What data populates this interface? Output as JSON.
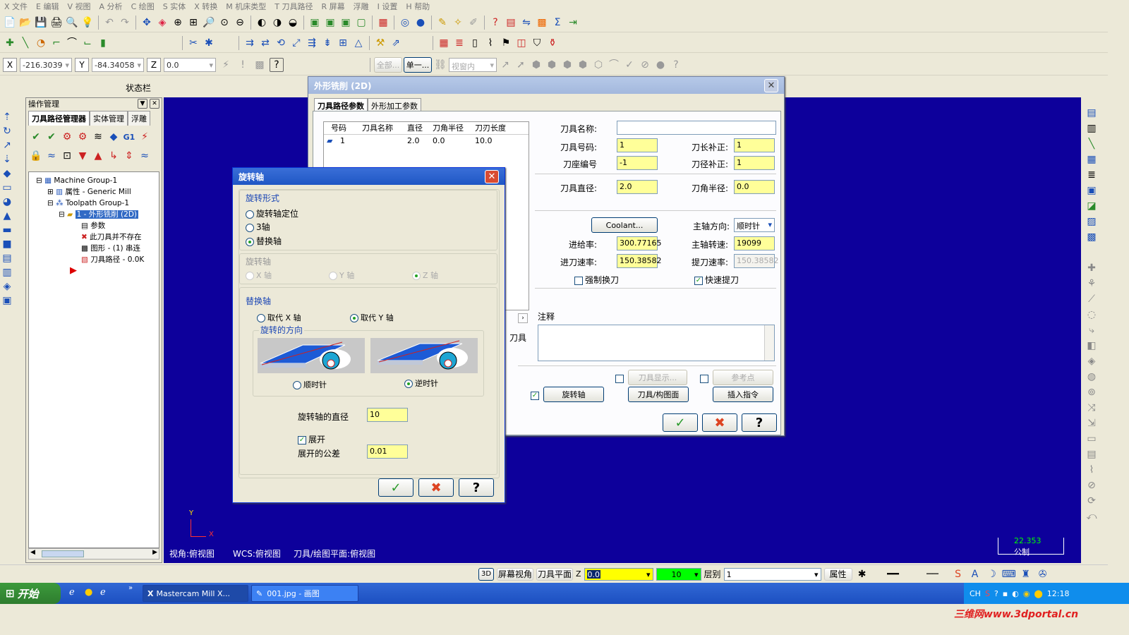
{
  "menu": [
    "X 文件",
    "E 编辑",
    "V 视图",
    "A 分析",
    "C 绘图",
    "S 实体",
    "X 转换",
    "M 机床类型",
    "T 刀具路径",
    "R 屏幕",
    "浮雕",
    "I 设置",
    "H 帮助"
  ],
  "coords": {
    "x_label": "X",
    "x_value": "-216.3039",
    "y_label": "Y",
    "y_value": "-84.34058",
    "z_label": "Z",
    "z_value": "0.0"
  },
  "toolbar3": {
    "all": "全部...",
    "single": "单一...",
    "view_in": "视窗内"
  },
  "status_bar_label": "状态栏",
  "ops": {
    "title": "操作管理",
    "tabs": [
      "刀具路径管理器",
      "实体管理",
      "浮雕"
    ],
    "tree": [
      "Machine Group-1",
      "属性 - Generic Mill",
      "Toolpath Group-1",
      "1 - 外形铣削 (2D)",
      "参数",
      "此刀具并不存在",
      "图形 - (1) 串连",
      "刀具路径 - 0.0K"
    ]
  },
  "viewport": {
    "view": "视角:俯视图",
    "wcs": "WCS:俯视图",
    "plane": "刀具/绘图平面:俯视图",
    "scale_value": "22.353",
    "scale_unit": "公制",
    "axis_y": "Y",
    "axis_x": "X"
  },
  "contour_dialog": {
    "title": "外形铣削 (2D)",
    "tabs": [
      "刀具路径参数",
      "外形加工参数"
    ],
    "tool_table": {
      "headers": [
        "号码",
        "刀具名称",
        "直径",
        "刀角半径",
        "刀刃长度"
      ],
      "row": [
        "1",
        "",
        "2.0",
        "0.0",
        "10.0"
      ]
    },
    "tool_name_label": "刀具名称:",
    "tool_name": "",
    "tool_num_label": "刀具号码:",
    "tool_num": "1",
    "len_comp_label": "刀长补正:",
    "len_comp": "1",
    "holder_label": "刀座编号",
    "holder": "-1",
    "dia_comp_label": "刀径补正:",
    "dia_comp": "1",
    "diameter_label": "刀具直径:",
    "diameter": "2.0",
    "corner_label": "刀角半径:",
    "corner": "0.0",
    "coolant": "Coolant...",
    "spindle_dir_label": "主轴方向:",
    "spindle_dir": "顺时针",
    "feed_label": "进给率:",
    "feed": "300.77165",
    "rpm_label": "主轴转速:",
    "rpm": "19099",
    "plunge_label": "进刀速率:",
    "plunge": "150.38582",
    "retract_label": "提刀速率:",
    "retract": "150.38582",
    "force_change": "强制换刀",
    "rapid_retract": "快速提刀",
    "comment_label": "注释",
    "partial_label": "刀具",
    "tool_display": "刀具显示...",
    "ref_point": "参考点",
    "rotary_axis": "旋转轴",
    "tool_plane": "刀具/构图面",
    "insert_cmd": "插入指令"
  },
  "rotary_dialog": {
    "title": "旋转轴",
    "form_label": "旋转形式",
    "form_opts": [
      "旋转轴定位",
      "3轴",
      "替换轴"
    ],
    "axis_label": "旋转轴",
    "axis_opts": [
      "X 轴",
      "Y 轴",
      "Z 轴"
    ],
    "replace_label": "替换轴",
    "replace_opts": [
      "取代 X 轴",
      "取代 Y 轴"
    ],
    "dir_label": "旋转的方向",
    "dir_opts": [
      "顺时针",
      "逆时针"
    ],
    "diameter_label": "旋转轴的直径",
    "diameter": "10",
    "unroll_label": "展开",
    "tol_label": "展开的公差",
    "tol": "0.01"
  },
  "bottom_bar": {
    "b3d": "3D",
    "screen_view": "屏幕视角",
    "tool_plane": "刀具平面",
    "z_label": "Z",
    "z_value": "0.0",
    "color": "10",
    "level_label": "层别",
    "level": "1",
    "attr": "属性"
  },
  "taskbar": {
    "start": "开始",
    "tasks": [
      "Mastercam Mill X...",
      "001.jpg - 画图"
    ],
    "tray_lang": "CH",
    "time": "12:18"
  },
  "watermark": "三维网www.3dportal.cn",
  "colors": {
    "canvas": "#0d009b",
    "field_yellow": "#ffff99",
    "title_active": "#1f57c4",
    "green": "#00ff00"
  }
}
